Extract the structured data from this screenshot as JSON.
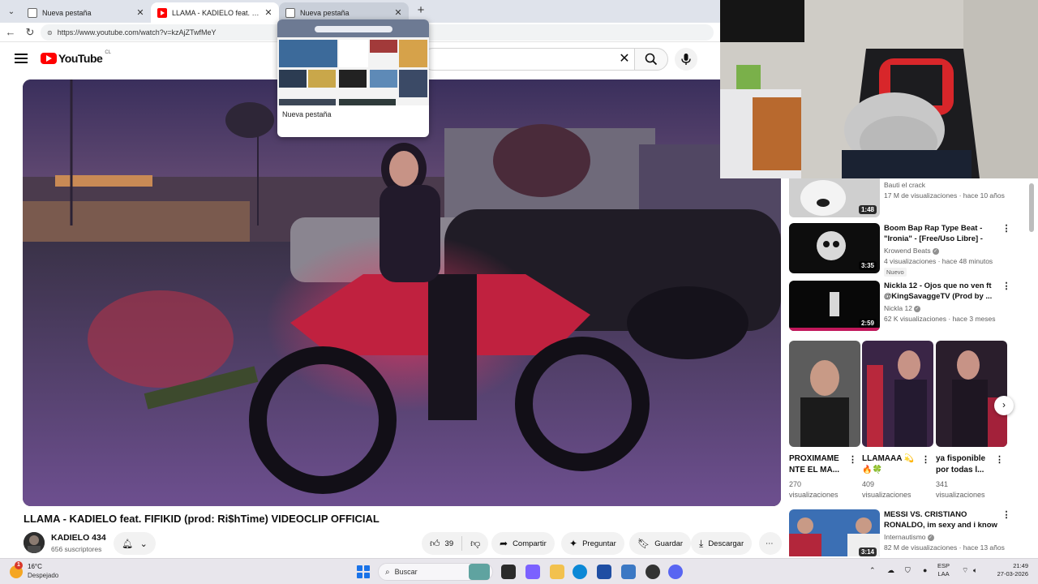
{
  "browser": {
    "tabs": [
      {
        "title": "Nueva pestaña",
        "favicon": "page-icon",
        "state": "normal"
      },
      {
        "title": "LLAMA - KADIELO feat. FIFIKID (pr",
        "favicon": "youtube-icon",
        "state": "active"
      },
      {
        "title": "Nueva pestaña",
        "favicon": "page-icon",
        "state": "hover"
      }
    ],
    "new_tab_label": "+",
    "close_glyph": "✕",
    "url": "https://www.youtube.com/watch?v=kzAjZTwfMeY",
    "tab_preview": {
      "label": "Nueva pestaña"
    }
  },
  "youtube": {
    "logo_text": "YouTube",
    "country_code": "CL",
    "video": {
      "title": "LLAMA - KADIELO feat. FIFIKID (prod: Ri$hTime) VIDEOCLIP OFFICIAL",
      "channel": "KADIELO 434",
      "subscribers": "656 suscriptores",
      "likes": "39",
      "actions": {
        "share": "Compartir",
        "ask": "Preguntar",
        "save": "Guardar",
        "download": "Descargar"
      }
    },
    "recommendations": [
      {
        "title": "",
        "channel": "Bauti el crack",
        "meta": "17 M de visualizaciones · hace 10 años",
        "duration": "1:48",
        "verified": false,
        "badge": ""
      },
      {
        "title": "Boom Bap Rap Type Beat - \"Ironia\" - [Free/Uso Libre] - (Pr...",
        "channel": "Krowend Beats",
        "meta": "4 visualizaciones · hace 48 minutos",
        "duration": "3:35",
        "verified": true,
        "badge": "Nuevo"
      },
      {
        "title": "Nickla 12 - Ojos que no ven ft @KingSavaggeTV (Prod by ...",
        "channel": "Nickla 12",
        "meta": "62 K visualizaciones · hace 3 meses",
        "duration": "2:59",
        "verified": true,
        "badge": ""
      },
      {
        "title": "MESSI VS. CRISTIANO RONALDO, im sexy and i know ...",
        "channel": "Internautismo",
        "meta": "82 M de visualizaciones · hace 13 años",
        "duration": "3:14",
        "verified": true,
        "badge": ""
      }
    ],
    "shorts": [
      {
        "title": "PROXIMAME NTE EL MA...",
        "views_line1": "270",
        "views_line2": "visualizaciones"
      },
      {
        "title": "LLAMAAA 💫🔥🍀",
        "views_line1": "409",
        "views_line2": "visualizaciones"
      },
      {
        "title": "ya fisponible por todas l...",
        "views_line1": "341",
        "views_line2": "visualizaciones"
      }
    ]
  },
  "taskbar": {
    "weather": {
      "temp": "16°C",
      "condition": "Despejado",
      "alert": "1"
    },
    "search_placeholder": "Buscar",
    "language": {
      "line1": "ESP",
      "line2": "LAA"
    },
    "clock": {
      "time": "21:49",
      "date": "27-03-2026"
    }
  }
}
